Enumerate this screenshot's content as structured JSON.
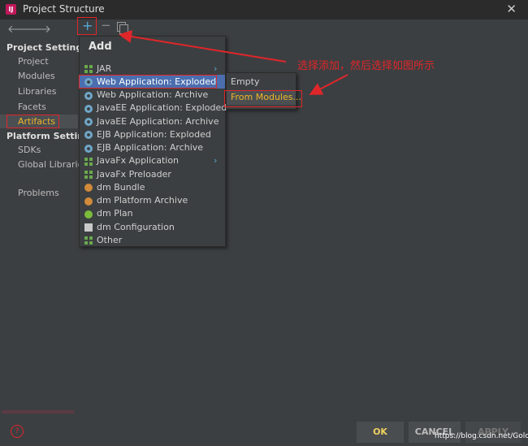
{
  "window": {
    "title": "Project Structure",
    "close": "✕"
  },
  "toolbar": {
    "back": "🡐",
    "forward": "🡒",
    "add": "+",
    "remove": "−"
  },
  "sidebar": {
    "project_settings_header": "Project Settings",
    "project_items": [
      "Project",
      "Modules",
      "Libraries",
      "Facets",
      "Artifacts"
    ],
    "platform_settings_header": "Platform Settings",
    "platform_items": [
      "SDKs",
      "Global Libraries"
    ],
    "problems": "Problems"
  },
  "add_menu": {
    "title": "Add",
    "items": [
      {
        "label": "JAR",
        "icon": "module-grid-icon",
        "submenu": true
      },
      {
        "label": "Web Application: Exploded",
        "icon": "web-gear-icon",
        "submenu": true
      },
      {
        "label": "Web Application: Archive",
        "icon": "web-gear-icon"
      },
      {
        "label": "JavaEE Application: Exploded",
        "icon": "web-gear-icon"
      },
      {
        "label": "JavaEE Application: Archive",
        "icon": "web-gear-icon"
      },
      {
        "label": "EJB Application: Exploded",
        "icon": "web-gear-icon"
      },
      {
        "label": "EJB Application: Archive",
        "icon": "web-gear-icon"
      },
      {
        "label": "JavaFx Application",
        "icon": "module-grid-icon",
        "submenu": true
      },
      {
        "label": "JavaFx Preloader",
        "icon": "module-grid-icon"
      },
      {
        "label": "dm Bundle",
        "icon": "bundle-icon"
      },
      {
        "label": "dm Platform Archive",
        "icon": "bundle-icon"
      },
      {
        "label": "dm Plan",
        "icon": "plan-icon"
      },
      {
        "label": "dm Configuration",
        "icon": "document-icon"
      },
      {
        "label": "Other",
        "icon": "module-grid-icon"
      }
    ]
  },
  "submenu": {
    "empty": "Empty",
    "from_modules": "From Modules..."
  },
  "annotation": "选择添加，然后选择如图所示",
  "buttons": {
    "ok": "OK",
    "cancel": "CANCEL",
    "apply": "APPLY",
    "help": "?"
  },
  "watermark": "https://blog.csdn.net/Golovin",
  "colors": {
    "highlight": "#4b6eaf",
    "annotation": "#e0262a",
    "selected_text": "#f0b429"
  }
}
